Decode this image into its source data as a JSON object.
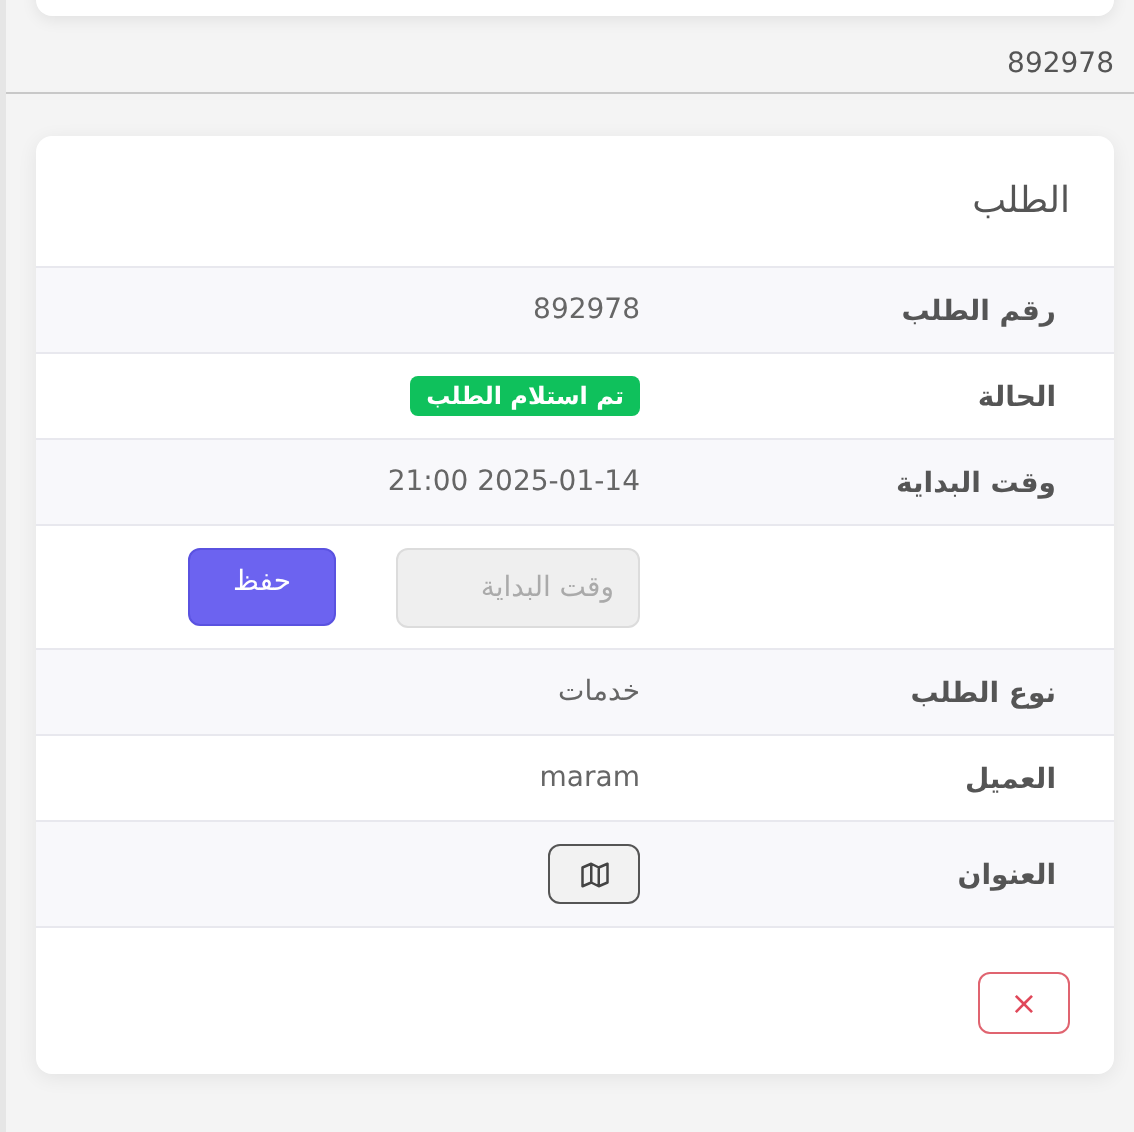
{
  "header": {
    "order_number": "892978"
  },
  "order_card": {
    "title": "الطلب",
    "rows": [
      {
        "kind": "text",
        "label": "رقم الطلب",
        "value": "892978"
      },
      {
        "kind": "badge",
        "label": "الحالة",
        "value": "تم استلام الطلب",
        "color": "#0fc15c"
      },
      {
        "kind": "text",
        "label": "وقت البداية",
        "value": "2025-01-14 21:00"
      },
      {
        "kind": "input_action",
        "placeholder": "وقت البداية",
        "disabled": true,
        "button": "حفظ"
      },
      {
        "kind": "text",
        "label": "نوع الطلب",
        "value": "خدمات"
      },
      {
        "kind": "text",
        "label": "العميل",
        "value": "maram"
      },
      {
        "kind": "map_button",
        "label": "العنوان"
      }
    ],
    "close_button": "×"
  }
}
